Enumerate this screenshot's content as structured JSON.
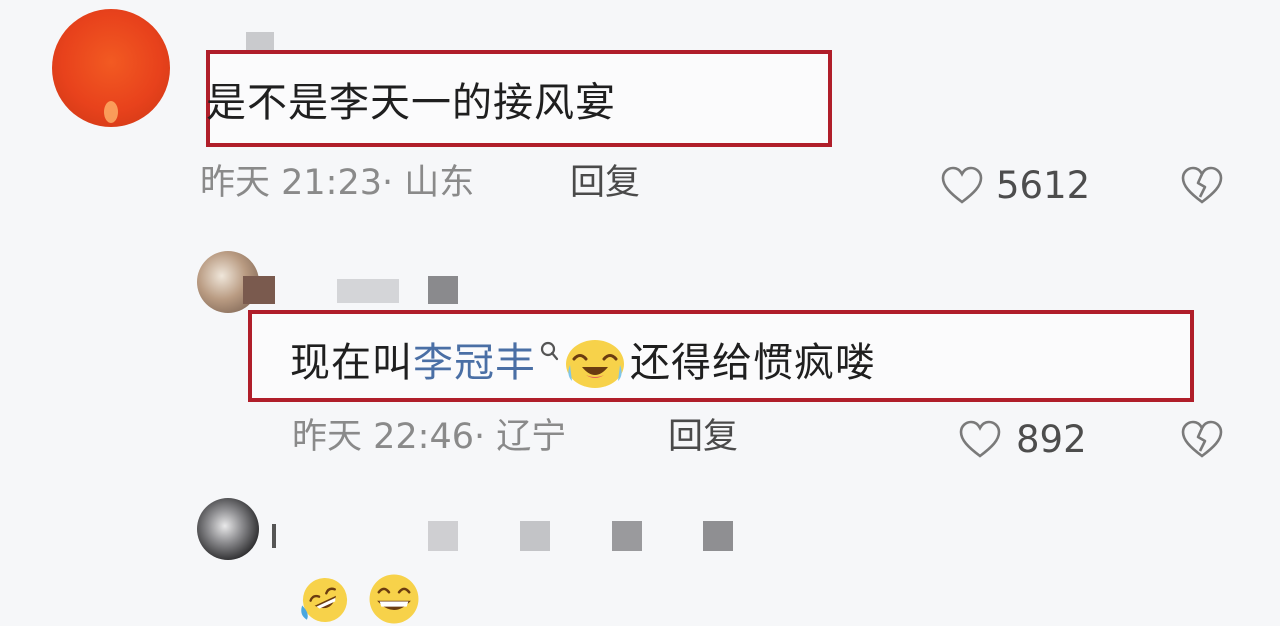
{
  "comments": [
    {
      "text": "是不是李天一的接风宴",
      "time": "昨天 21:23",
      "location": "山东",
      "reply_label": "回复",
      "likes": "5612",
      "icons": [
        "heart-icon",
        "broken-heart-icon"
      ]
    },
    {
      "text_before_link": "现在叫",
      "link_text": "李冠丰",
      "text_after_emoji": "还得给惯疯喽",
      "time": "昨天 22:46",
      "location": "辽宁",
      "reply_label": "回复",
      "likes": "892",
      "icons": [
        "search-icon",
        "laughing-tears-emoji",
        "heart-icon",
        "broken-heart-icon"
      ]
    },
    {
      "icons": [
        "rofl-emoji",
        "grin-emoji"
      ]
    }
  ],
  "colors": {
    "highlight_border": "#b01e2a",
    "link": "#4a6fa5",
    "text": "#1f1f1f",
    "meta": "#8a8a8a"
  }
}
